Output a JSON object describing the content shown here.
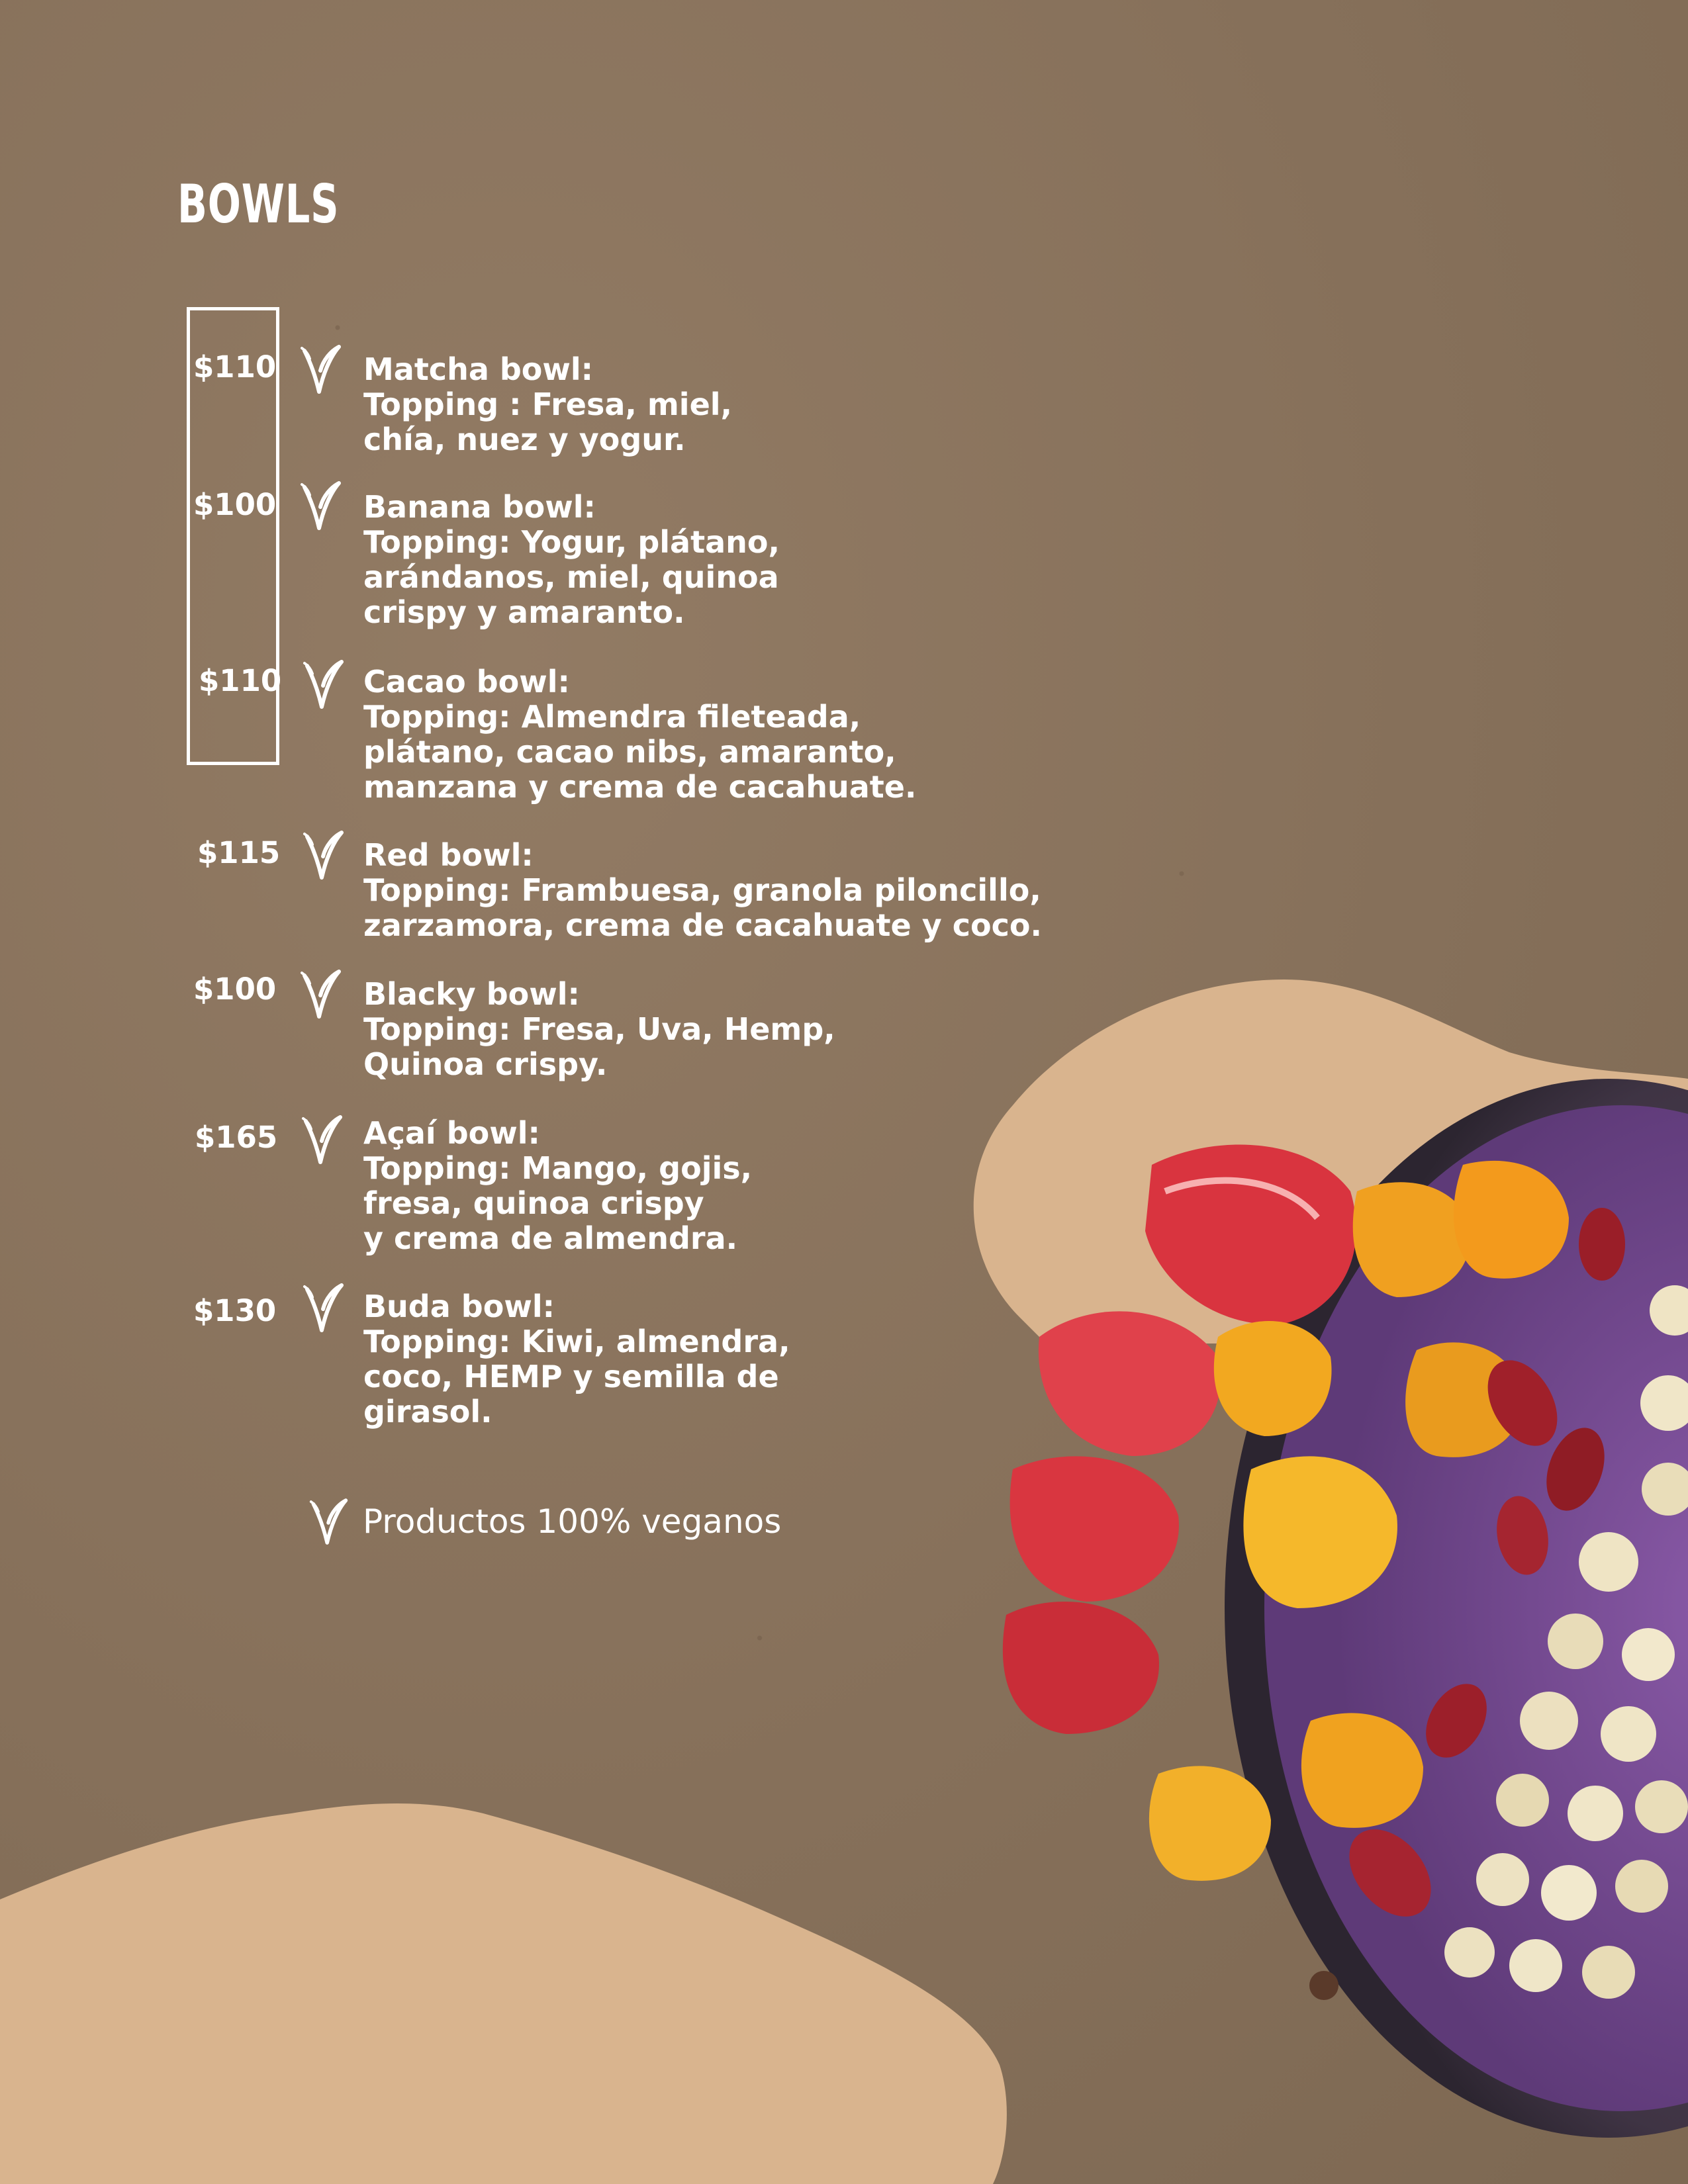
{
  "title": "BOWLS",
  "items": [
    {
      "price": "$110",
      "name": "Matcha bowl:",
      "lines": [
        "Topping : Fresa, miel,",
        "chía, nuez y yogur."
      ]
    },
    {
      "price": "$100",
      "name": "Banana bowl:",
      "lines": [
        "Topping: Yogur, plátano,",
        "arándanos, miel, quinoa",
        "crispy y amaranto."
      ]
    },
    {
      "price": "$110",
      "name": "Cacao bowl:",
      "lines": [
        "Topping: Almendra fileteada,",
        "plátano, cacao nibs, amaranto,",
        "manzana y crema de cacahuate."
      ]
    },
    {
      "price": "$115",
      "name": "Red bowl:",
      "lines": [
        "Topping: Frambuesa, granola piloncillo,",
        "zarzamora, crema de cacahuate y coco."
      ]
    },
    {
      "price": "$100",
      "name": "Blacky bowl:",
      "lines": [
        "Topping: Fresa, Uva, Hemp,",
        "Quinoa crispy."
      ]
    },
    {
      "price": "$165",
      "name": "Açaí bowl:",
      "lines": [
        "Topping: Mango, gojis,",
        "fresa, quinoa crispy",
        "y crema de almendra."
      ]
    },
    {
      "price": "$130",
      "name": "Buda bowl:",
      "lines": [
        "Topping: Kiwi, almendra,",
        "coco, HEMP y semilla de",
        "girasol."
      ]
    }
  ],
  "footer": "Productos 100% veganos",
  "icons": {
    "vegan": "vegan-leaf-icon"
  },
  "colors": {
    "background": "#8c755e",
    "blob": "#d9b48e",
    "text": "#ffffff"
  }
}
